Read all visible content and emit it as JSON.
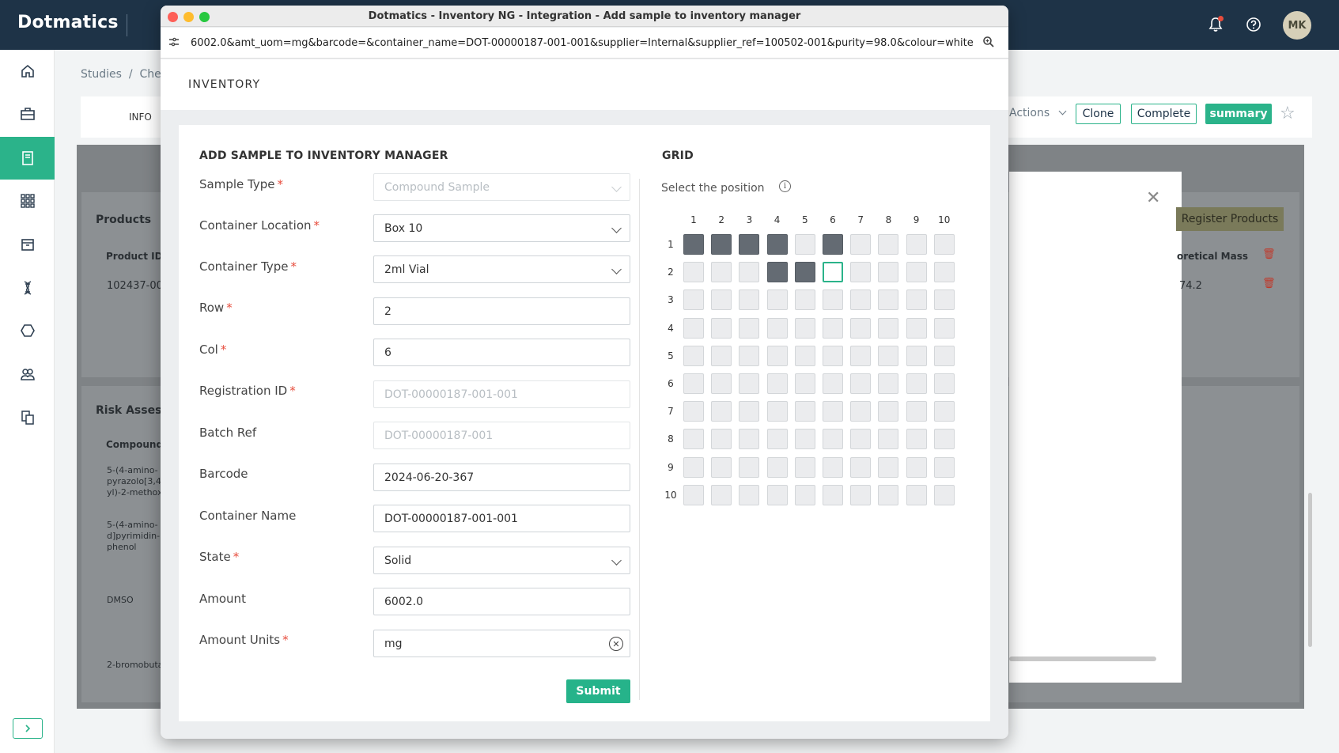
{
  "app": {
    "brand": "Dotmatics",
    "avatar_initials": "MK"
  },
  "background": {
    "breadcrumbs": "Studies  /  Che",
    "tab_info": "INFO",
    "actions_label": "Actions",
    "clone_label": "Clone",
    "complete_label": "Complete",
    "summary_label": "summary",
    "products_heading": "Products",
    "product_id_header": "Product ID",
    "product_id_value": "102437-00",
    "theoretical_mass_header": "oretical Mass",
    "theoretical_mass_value": "74.2",
    "register_products_label": "Register Products",
    "risk_heading": "Risk Assessm",
    "compound_header": "Compound",
    "compound_1": "5-(4-amino-\npyrazolo[3,4\nyl)-2-methox",
    "compound_2": "5-(4-amino-\nd]pyrimidin-\nphenol",
    "compound_3": "DMSO",
    "compound_4": "2-bromobuta"
  },
  "window": {
    "title": "Dotmatics - Inventory NG - Integration - Add sample to inventory manager",
    "url": "6002.0&amt_uom=mg&barcode=&container_name=DOT-00000187-001-001&supplier=Internal&supplier_ref=100502-001&purity=98.0&colour=white",
    "header": "INVENTORY"
  },
  "form": {
    "title": "ADD SAMPLE TO INVENTORY MANAGER",
    "fields": [
      {
        "label": "Sample Type",
        "required": "*",
        "value": "Compound Sample"
      },
      {
        "label": "Container Location",
        "required": "*",
        "value": "Box 10"
      },
      {
        "label": "Container Type",
        "required": "*",
        "value": "2ml Vial"
      },
      {
        "label": "Row",
        "required": "*",
        "value": "2"
      },
      {
        "label": "Col",
        "required": "*",
        "value": "6"
      },
      {
        "label": "Registration ID",
        "required": "*",
        "value": "DOT-00000187-001-001"
      },
      {
        "label": "Batch Ref",
        "required": "",
        "value": "DOT-00000187-001"
      },
      {
        "label": "Barcode",
        "required": "",
        "value": "2024-06-20-367"
      },
      {
        "label": "Container Name",
        "required": "",
        "value": "DOT-00000187-001-001"
      },
      {
        "label": "State",
        "required": "*",
        "value": "Solid"
      },
      {
        "label": "Amount",
        "required": "",
        "value": "6002.0"
      },
      {
        "label": "Amount Units",
        "required": "*",
        "value": "mg"
      }
    ],
    "submit_label": "Submit"
  },
  "grid": {
    "title": "GRID",
    "instruction": "Select the position",
    "info_glyph": "i",
    "columns": [
      "1",
      "2",
      "3",
      "4",
      "5",
      "6",
      "7",
      "8",
      "9",
      "10"
    ],
    "rows": [
      "1",
      "2",
      "3",
      "4",
      "5",
      "6",
      "7",
      "8",
      "9",
      "10"
    ],
    "occupied": [
      [
        1,
        1
      ],
      [
        1,
        2
      ],
      [
        1,
        3
      ],
      [
        1,
        4
      ],
      [
        1,
        6
      ],
      [
        2,
        4
      ],
      [
        2,
        5
      ]
    ],
    "selected": [
      2,
      6
    ]
  }
}
